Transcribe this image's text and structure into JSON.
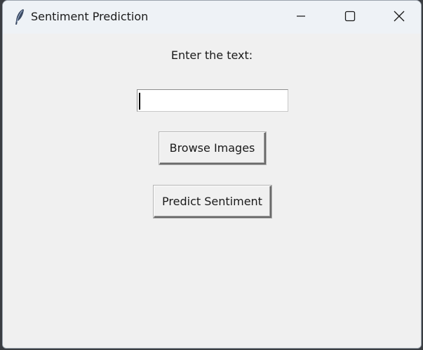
{
  "window": {
    "title": "Sentiment Prediction",
    "app_icon": "feather-icon",
    "controls": {
      "minimize_icon": "minimize-icon",
      "maximize_icon": "maximize-icon",
      "close_icon": "close-icon"
    }
  },
  "form": {
    "prompt_label": "Enter the text:",
    "text_input_value": "",
    "browse_button_label": "Browse Images",
    "predict_button_label": "Predict Sentiment"
  },
  "colors": {
    "titlebar_bg": "#eef2f6",
    "content_bg": "#f0f0f0",
    "input_bg": "#ffffff"
  }
}
